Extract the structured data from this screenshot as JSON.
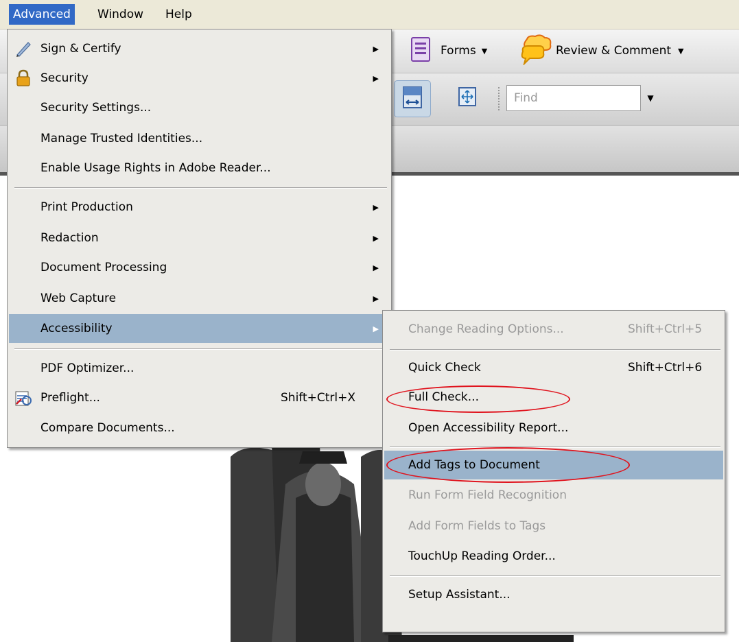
{
  "menubar": {
    "items": [
      "Advanced",
      "Window",
      "Help"
    ]
  },
  "toolbar": {
    "forms_label": "Forms",
    "review_label": "Review & Comment",
    "find_placeholder": "Find",
    "dropdown_glyph": "▼"
  },
  "advanced_menu": {
    "items": [
      {
        "label": "Sign & Certify"
      },
      {
        "label": "Security"
      },
      {
        "label": "Security Settings..."
      },
      {
        "label": "Manage Trusted Identities..."
      },
      {
        "label": "Enable Usage Rights in Adobe Reader..."
      },
      {
        "label": "Print Production"
      },
      {
        "label": "Redaction"
      },
      {
        "label": "Document Processing"
      },
      {
        "label": "Web Capture"
      },
      {
        "label": "Accessibility"
      },
      {
        "label": "PDF Optimizer..."
      },
      {
        "label": "Preflight...",
        "shortcut": "Shift+Ctrl+X"
      },
      {
        "label": "Compare Documents..."
      }
    ]
  },
  "accessibility_menu": {
    "items": [
      {
        "label": "Change Reading Options...",
        "shortcut": "Shift+Ctrl+5",
        "enabled": false
      },
      {
        "label": "Quick Check",
        "shortcut": "Shift+Ctrl+6",
        "enabled": true
      },
      {
        "label": "Full Check...",
        "enabled": true
      },
      {
        "label": "Open Accessibility Report...",
        "enabled": true
      },
      {
        "label": "Add Tags to Document",
        "enabled": true
      },
      {
        "label": "Run Form Field Recognition",
        "enabled": false
      },
      {
        "label": "Add Form Fields to Tags",
        "enabled": false
      },
      {
        "label": "TouchUp Reading Order...",
        "enabled": true
      },
      {
        "label": "Setup Assistant...",
        "enabled": true
      }
    ]
  },
  "colors": {
    "highlight": "#9ab3cb",
    "menubar_active": "#3169c6",
    "annotation": "#e0141e"
  }
}
